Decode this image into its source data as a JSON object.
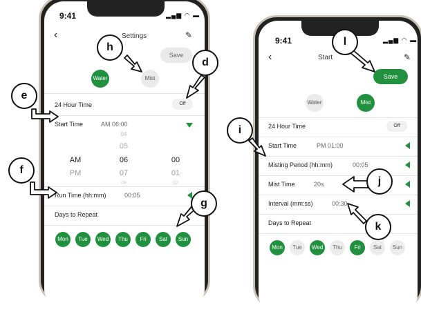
{
  "left": {
    "status_time": "9:41",
    "title": "Settings",
    "save_label": "Save",
    "tabs": [
      {
        "label": "Water",
        "active": true
      },
      {
        "label": "Mist",
        "active": false
      }
    ],
    "hour24_label": "24 Hour Time",
    "hour24_toggle": "Off",
    "start_time_label": "Start Time",
    "start_time_value": "AM 06:00",
    "picker": {
      "col1": [
        "",
        "",
        "AM",
        "PM",
        ""
      ],
      "col2": [
        "04",
        "05",
        "06",
        "07",
        "08"
      ],
      "col3": [
        "",
        "",
        "00",
        "01",
        "02"
      ]
    },
    "run_time_label": "Run Time (hh:mm)",
    "run_time_value": "00:05",
    "days_label": "Days to Repeat",
    "days": [
      {
        "label": "Mon",
        "on": true
      },
      {
        "label": "Tue",
        "on": true
      },
      {
        "label": "Wed",
        "on": true
      },
      {
        "label": "Thu",
        "on": true
      },
      {
        "label": "Fri",
        "on": true
      },
      {
        "label": "Sat",
        "on": true
      },
      {
        "label": "Sun",
        "on": true
      }
    ]
  },
  "right": {
    "status_time": "9:41",
    "title": "Start",
    "save_label": "Save",
    "tabs": [
      {
        "label": "Water",
        "active": false
      },
      {
        "label": "Mist",
        "active": true
      }
    ],
    "hour24_label": "24 Hour Time",
    "hour24_toggle": "Off",
    "start_time_label": "Start Time",
    "start_time_value": "PM 01:00",
    "misting_label": "Misting Period (hh:mm)",
    "misting_value": "00:05",
    "mist_time_label": "Mist Time",
    "mist_time_value": "20s",
    "interval_label": "Interval (mm:ss)",
    "interval_value": "00:30",
    "days_label": "Days to Repeat",
    "days": [
      {
        "label": "Mon",
        "on": true
      },
      {
        "label": "Tue",
        "on": false
      },
      {
        "label": "Wed",
        "on": true
      },
      {
        "label": "Thu",
        "on": false
      },
      {
        "label": "Fri",
        "on": true
      },
      {
        "label": "Sat",
        "on": false
      },
      {
        "label": "Sun",
        "on": false
      }
    ]
  },
  "callouts": [
    "d",
    "e",
    "f",
    "g",
    "h",
    "i",
    "j",
    "k",
    "l"
  ],
  "colors": {
    "accent": "#21913f",
    "frame": "#c9c0b4"
  }
}
